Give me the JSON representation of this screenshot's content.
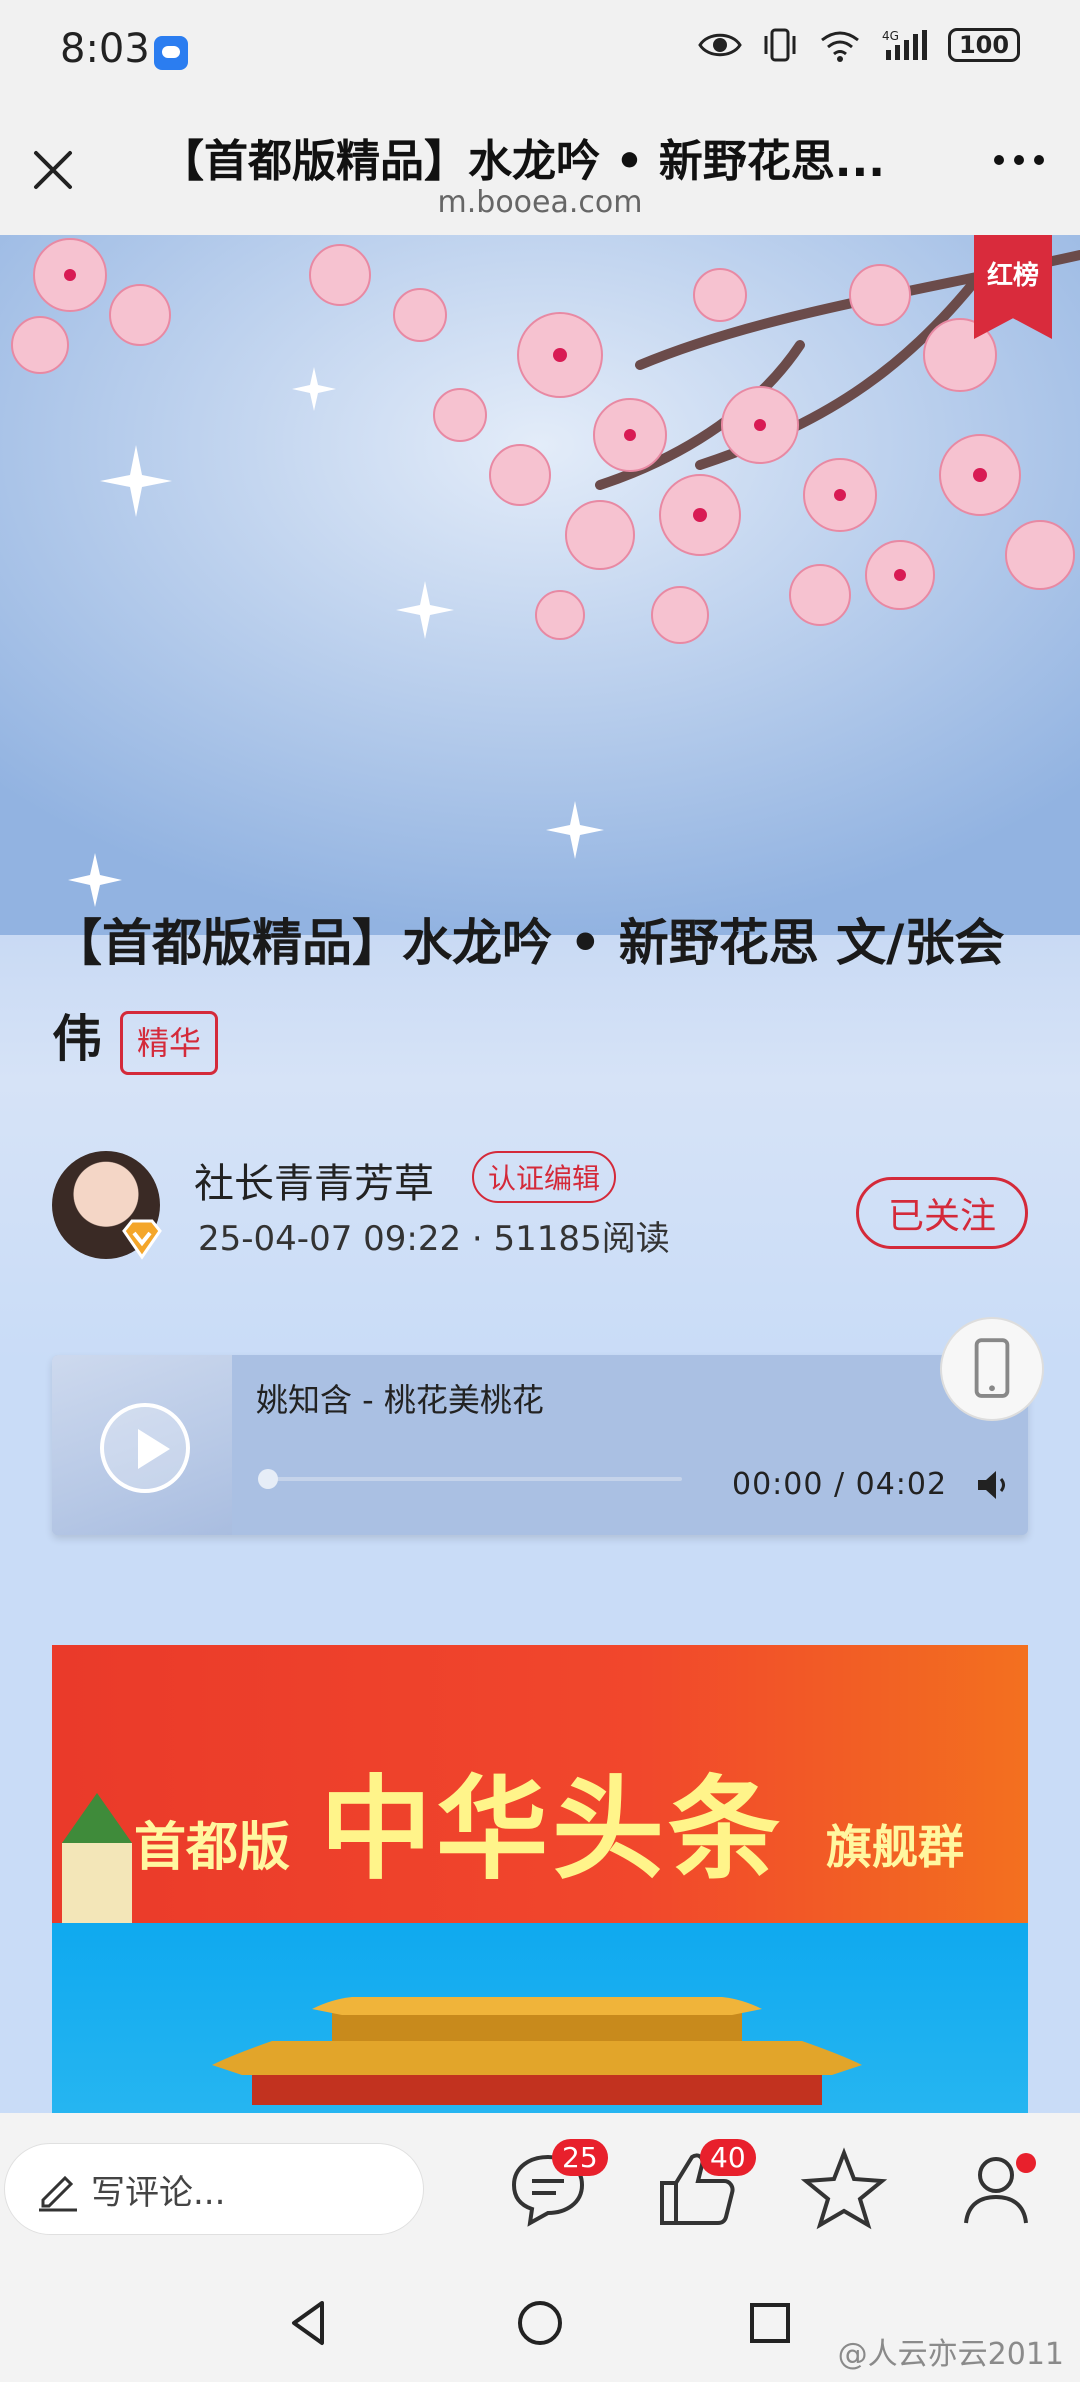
{
  "status_bar": {
    "time": "8:03",
    "battery": "100"
  },
  "browser": {
    "title": "【首都版精品】水龙吟 • 新野花思...",
    "url": "m.booea.com"
  },
  "hero": {
    "ribbon": "红榜"
  },
  "article": {
    "title": "【首都版精品】水龙吟 • 新野花思 文/张会伟",
    "badge": "精华",
    "author": "社长青青芳草",
    "author_badge": "认证编辑",
    "meta": "25-04-07 09:22 · 51185阅读",
    "follow_label": "已关注"
  },
  "player": {
    "song": "姚知含 - 桃花美桃花",
    "time": "00:00 / 04:02",
    "progress": 0
  },
  "banner": {
    "sub": "首都版",
    "main": "中华头条",
    "tail": "旗舰群"
  },
  "bottom_bar": {
    "comment_placeholder": "写评论...",
    "comment_count": "25",
    "like_count": "40"
  },
  "watermark": "@人云亦云2011",
  "icons": {
    "close": "close-icon",
    "more": "more-icon",
    "play": "play-icon",
    "volume": "volume-icon",
    "device": "phone-icon",
    "pencil": "pencil-icon",
    "comment": "comment-icon",
    "like": "thumbs-up-icon",
    "star": "star-icon",
    "profile": "user-icon",
    "back": "back-triangle-icon",
    "home": "home-circle-icon",
    "recents": "recents-square-icon"
  },
  "colors": {
    "accent": "#d42a3a",
    "badge_red": "#e8202c"
  }
}
